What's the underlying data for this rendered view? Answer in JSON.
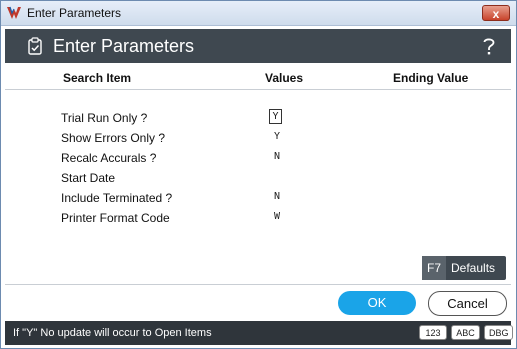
{
  "window": {
    "title": "Enter Parameters",
    "close_label": "x"
  },
  "header": {
    "title": "Enter Parameters",
    "help_label": "?"
  },
  "columns": {
    "search_item": "Search Item",
    "values": "Values",
    "ending_value": "Ending Value"
  },
  "parameters": [
    {
      "label": "Trial Run Only ?",
      "value": "Y"
    },
    {
      "label": "Show Errors Only ?",
      "value": "Y"
    },
    {
      "label": "Recalc Accurals ?",
      "value": "N"
    },
    {
      "label": "Start Date",
      "value": ""
    },
    {
      "label": "Include Terminated ?",
      "value": "N"
    },
    {
      "label": "Printer Format Code",
      "value": "W"
    }
  ],
  "defaults_button": {
    "key": "F7",
    "label": "Defaults"
  },
  "actions": {
    "ok_label": "OK",
    "cancel_label": "Cancel"
  },
  "status_bar": {
    "message": "If \"Y\" No update will occur to Open Items",
    "badges": [
      "123",
      "ABC",
      "DBG"
    ]
  },
  "colors": {
    "header_bg": "#3f4850",
    "accent_ok": "#1aa4e8",
    "status_bg": "#2f353b"
  }
}
